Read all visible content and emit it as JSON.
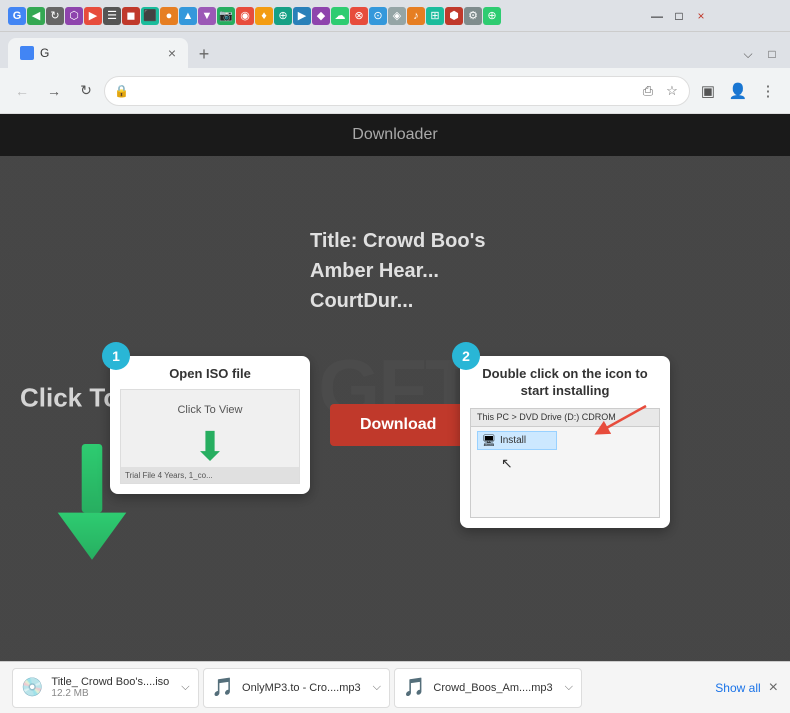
{
  "browser": {
    "tab_label": "G",
    "tab_close": "×",
    "tab_new": "+",
    "nav_back": "←",
    "nav_forward": "→",
    "nav_refresh": "↻",
    "address": "",
    "lock_icon": "🔒",
    "minimize": "—",
    "restore": "□",
    "close": "×",
    "menu": "⋮",
    "star": "☆",
    "share": "⎙",
    "extensions": "⬚",
    "profile": "👤"
  },
  "page": {
    "header_title": "Downloader",
    "click_to_view": "Click To View",
    "title_line1": "Title: Crowd Boo's",
    "title_line2": "Amber Hear...",
    "title_line3": "CourtDur...",
    "download_btn": "Download"
  },
  "step1": {
    "badge": "1",
    "title": "Open ISO file",
    "image_text": "Click To View",
    "bottom_bar_text": "Trial File 4 Years, 1_co..."
  },
  "step2": {
    "badge": "2",
    "title": "Double click on the icon to start installing",
    "breadcrumb": "This PC  >  DVD Drive (D:) CDROM",
    "install_item": "Install",
    "cursor": "↖"
  },
  "download_bar": {
    "item1_name": "Title_ Crowd Boo's....iso",
    "item1_size": "12.2 MB",
    "item1_icon": "💿",
    "item2_name": "OnlyMP3.to - Cro....mp3",
    "item2_size": "",
    "item2_icon": "🎵",
    "item3_name": "Crowd_Boos_Am....mp3",
    "item3_size": "",
    "item3_icon": "🎵",
    "show_all": "Show all",
    "close": "×"
  },
  "ext_icons": [
    "G",
    "◀",
    "↻",
    "⬡",
    "▶",
    "☰",
    "◼",
    "⬛",
    "●",
    "▲",
    "▼",
    "📷",
    "◉",
    "♦",
    "⊕",
    "▶",
    "◆",
    "☁",
    "⊗",
    "⊙",
    "◈",
    "♪",
    "⊞",
    "⬢",
    "⚙",
    "⊕"
  ]
}
